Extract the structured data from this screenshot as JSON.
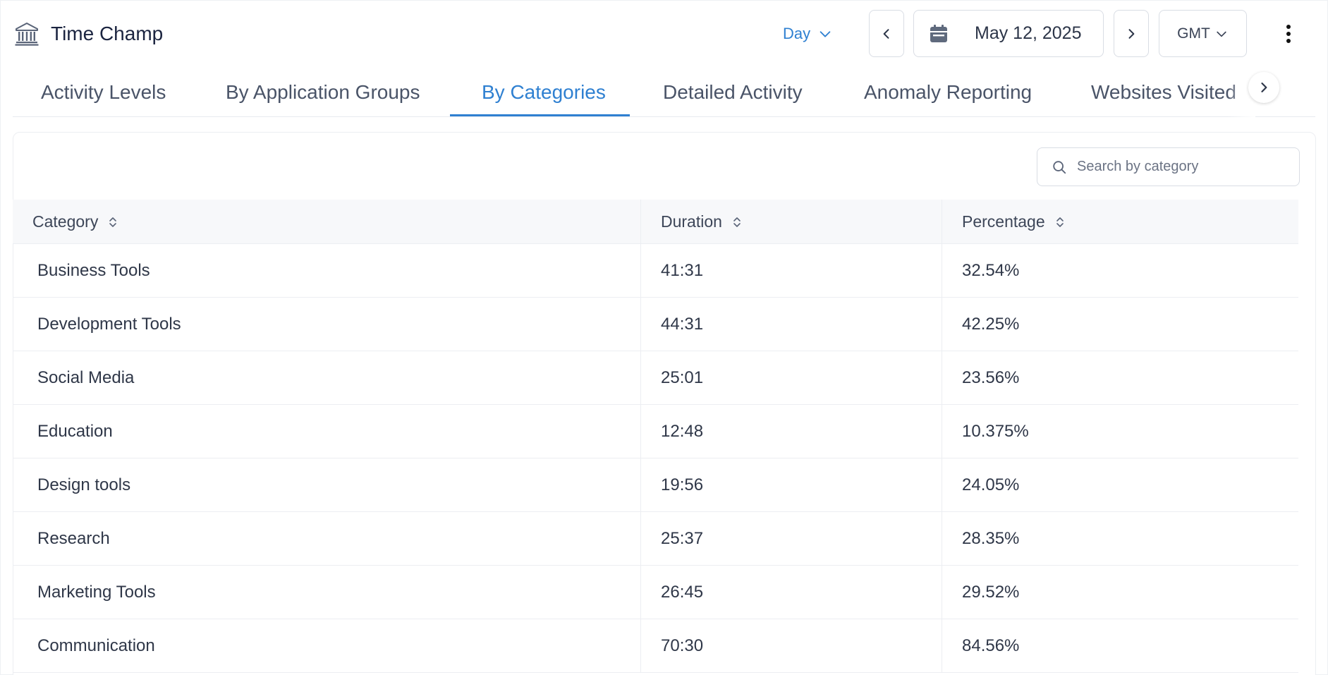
{
  "header": {
    "app_title": "Time Champ",
    "logo_icon": "bank-icon",
    "period": "Day",
    "date": "May 12, 2025",
    "timezone": "GMT"
  },
  "tabs": [
    {
      "label": "Activity Levels",
      "active": false
    },
    {
      "label": "By Application Groups",
      "active": false
    },
    {
      "label": "By Categories",
      "active": true
    },
    {
      "label": "Detailed Activity",
      "active": false
    },
    {
      "label": "Anomaly Reporting",
      "active": false
    },
    {
      "label": "Websites Visited",
      "active": false
    }
  ],
  "search": {
    "placeholder": "Search by category"
  },
  "table": {
    "columns": [
      "Category",
      "Duration",
      "Percentage"
    ],
    "rows": [
      {
        "category": "Business Tools",
        "duration": "41:31",
        "percentage": "32.54%"
      },
      {
        "category": "Development Tools",
        "duration": "44:31",
        "percentage": "42.25%"
      },
      {
        "category": "Social Media",
        "duration": "25:01",
        "percentage": "23.56%"
      },
      {
        "category": "Education",
        "duration": "12:48",
        "percentage": "10.375%"
      },
      {
        "category": "Design tools",
        "duration": "19:56",
        "percentage": "24.05%"
      },
      {
        "category": "Research",
        "duration": "25:37",
        "percentage": "28.35%"
      },
      {
        "category": "Marketing Tools",
        "duration": "26:45",
        "percentage": "29.52%"
      },
      {
        "category": "Communication",
        "duration": "70:30",
        "percentage": "84.56%"
      }
    ]
  },
  "colors": {
    "accent": "#2f80d1",
    "text": "#1f2a44",
    "border": "#d9dde4"
  }
}
